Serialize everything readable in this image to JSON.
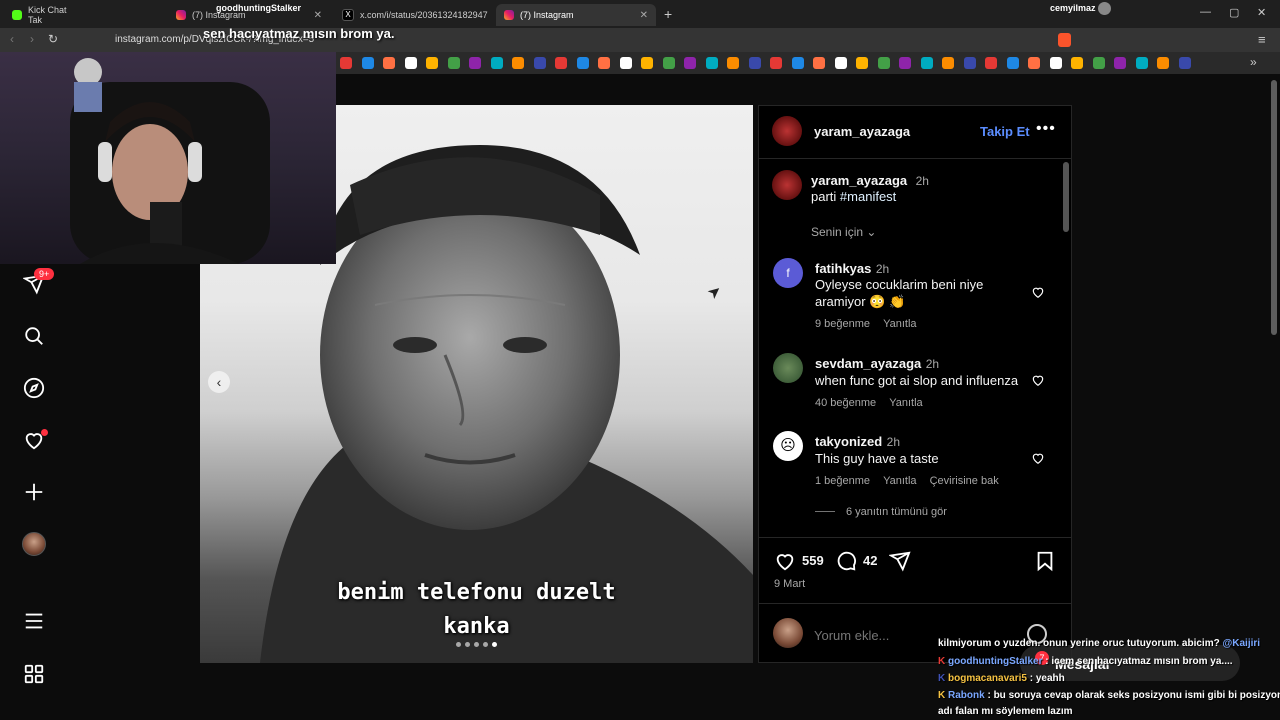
{
  "browser": {
    "tabs": [
      {
        "label": "Kick Chat Tak",
        "active": false
      },
      {
        "label": "(7) Instagram",
        "active": false
      },
      {
        "label": "x.com/i/status/20361324182947210",
        "active": false
      },
      {
        "label": "(7) Instagram",
        "active": true
      }
    ],
    "overlay_username": "goodhuntingStalker",
    "profile_name": "cemyilmaz",
    "url": "instagram.com/p/DVqlszfCCk-/?img_index=5",
    "overlay_message": "sen hacıyatmaz mısın brom ya."
  },
  "sidebar": {
    "notification_badge": "9+",
    "items": [
      "notifications-icon",
      "search-icon",
      "explore-icon",
      "activity-icon",
      "create-icon",
      "profile-avatar",
      "menu-icon",
      "more-icon"
    ]
  },
  "post": {
    "caption_line1": "benim telefonu duzelt",
    "caption_line2": "kanka",
    "carousel_dots": 5,
    "carousel_active": 5,
    "author": "yaram_ayazaga",
    "follow_label": "Takip Et",
    "caption_user": "yaram_ayazaga",
    "caption_time": "2h",
    "caption_text": "parti",
    "caption_hashtag": "#manifest",
    "sort_label": "Senin için",
    "comments": [
      {
        "user": "fatihkyas",
        "time": "2h",
        "text": "Oyleyse cocuklarim beni niye aramiyor 😳 👏",
        "likes": "9 beğenme",
        "reply": "Yanıtla",
        "translate": ""
      },
      {
        "user": "sevdam_ayazaga",
        "time": "2h",
        "text": "when func got ai slop and influenza",
        "likes": "40 beğenme",
        "reply": "Yanıtla",
        "translate": ""
      },
      {
        "user": "takyonized",
        "time": "2h",
        "text": "This guy have a taste",
        "likes": "1 beğenme",
        "reply": "Yanıtla",
        "translate": "Çevirisine bak"
      }
    ],
    "view_replies": "6 yanıtın tümünü gör",
    "like_count": "559",
    "comment_count": "42",
    "date": "9 Mart",
    "comment_placeholder": "Yorum ekle..."
  },
  "messages": {
    "label": "Mesajlar",
    "badge": "7"
  },
  "chat": {
    "lines": [
      {
        "user": "",
        "text": "kilmiyorum o yuzden. onun yerine oruc tutuyorum. abicim?",
        "mention": "@Kaijiri"
      },
      {
        "user": "goodhuntingStalker",
        "text": ": icem sen hacıyatmaz mısın brom ya....",
        "mention": ""
      },
      {
        "user": "bogmacanavari5",
        "text": ": yeahh",
        "mention": ""
      },
      {
        "user": "Rabonk",
        "text": ": bu soruya cevap olarak seks posizyonu ismi gibi bi posizyon",
        "mention": ""
      },
      {
        "user": "",
        "text": "adı falan mı söylemem lazım",
        "mention": ""
      }
    ]
  },
  "colors": {
    "accent_blue": "#5b8dff",
    "hashtag": "#e0f1ff",
    "badge_red": "#ff3040",
    "chat_mention": "#7aa7ff"
  }
}
